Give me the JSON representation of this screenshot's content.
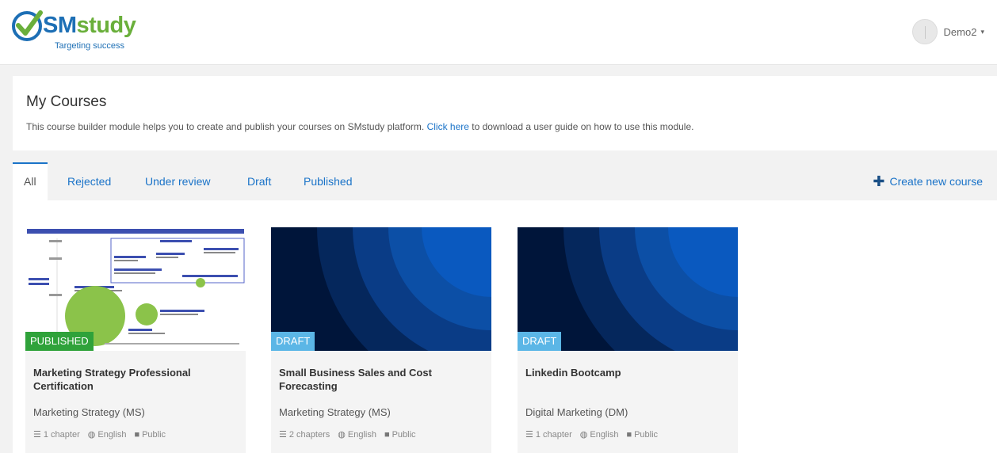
{
  "brand": {
    "name_part1": "SM",
    "name_part2": "study",
    "tagline": "Targeting success",
    "colors": {
      "blue": "#1d6fb5",
      "green": "#6aaf3b"
    }
  },
  "user": {
    "name": "Demo2",
    "caret": "▾"
  },
  "header": {
    "title": "My Courses",
    "desc_before": "This course builder module helps you to create and publish your courses on SMstudy platform. ",
    "link_text": "Click here",
    "desc_after": " to download a user guide on how to use this module."
  },
  "tabs": [
    {
      "label": "All",
      "active": true
    },
    {
      "label": "Rejected"
    },
    {
      "label": "Under review"
    },
    {
      "label": "Draft"
    },
    {
      "label": "Published"
    }
  ],
  "create_label": "Create new course",
  "courses": [
    {
      "status": "PUBLISHED",
      "title": "Marketing Strategy Professional Certification",
      "category": "Marketing Strategy (MS)",
      "chapters": "1 chapter",
      "language": "English",
      "visibility": "Public"
    },
    {
      "status": "DRAFT",
      "title": "Small Business Sales and Cost Forecasting",
      "category": "Marketing Strategy (MS)",
      "chapters": "2 chapters",
      "language": "English",
      "visibility": "Public"
    },
    {
      "status": "DRAFT",
      "title": "Linkedin Bootcamp",
      "category": "Digital Marketing (DM)",
      "chapters": "1 chapter",
      "language": "English",
      "visibility": "Public"
    }
  ],
  "icons": {
    "logo": "smstudy-check-logo-icon",
    "chapters": "list-icon",
    "language": "globe-icon",
    "visibility": "briefcase-icon",
    "create": "plus-icon"
  },
  "colors": {
    "accent": "#1a73c8",
    "published": "#2fa23a",
    "draft": "#5bb6e6"
  }
}
